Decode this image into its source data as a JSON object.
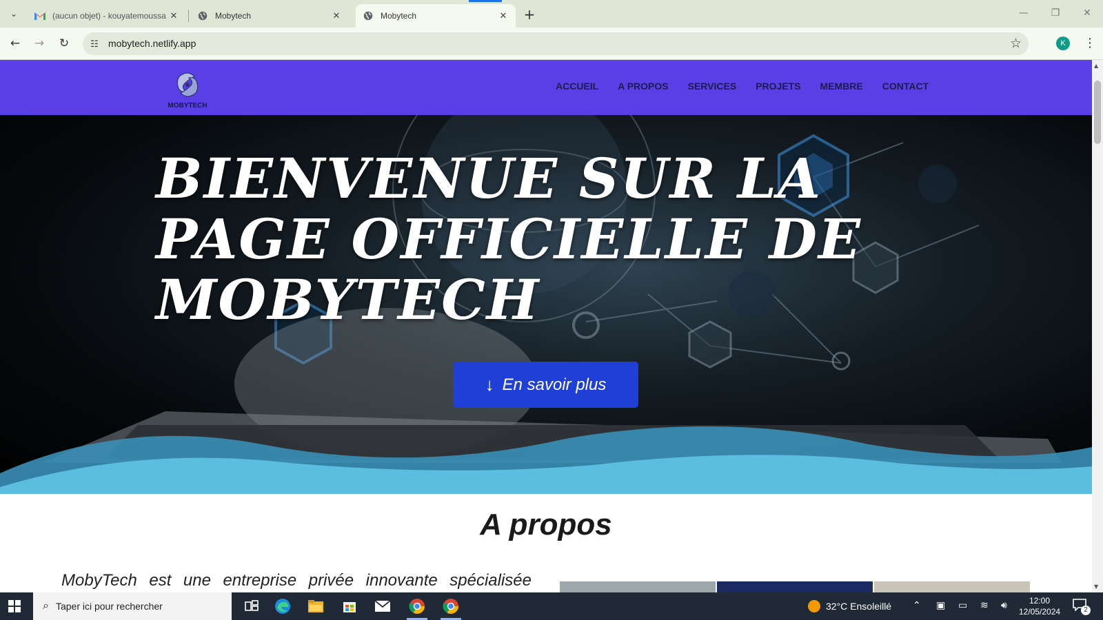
{
  "browser": {
    "tabs": [
      {
        "title": "(aucun objet) - kouyatemoussa",
        "favicon": "gmail-icon",
        "active": false
      },
      {
        "title": "Mobytech",
        "favicon": "globe-icon",
        "active": false
      },
      {
        "title": "Mobytech",
        "favicon": "globe-icon",
        "active": true
      }
    ],
    "url": "mobytech.netlify.app",
    "profile_initial": "K"
  },
  "site": {
    "logo_text": "MOBYTECH",
    "nav": [
      "ACCUEIL",
      "A PROPOS",
      "SERVICES",
      "PROJETS",
      "MEMBRE",
      "CONTACT"
    ],
    "hero_title": "BIENVENUE SUR LA PAGE OFFICIELLE DE MOBYTECH",
    "cta_label": "En savoir plus",
    "about_title": "A propos",
    "about_text": "MobyTech est une entreprise privée innovante spécialisée",
    "colors": {
      "nav_bg": "#5b3fe6",
      "cta_bg": "#1f3fd6",
      "wave": "#5bbde0"
    }
  },
  "taskbar": {
    "search_placeholder": "Taper ici pour rechercher",
    "weather": "32°C  Ensoleillé",
    "time": "12:00",
    "date": "12/05/2024",
    "notification_count": "2"
  }
}
